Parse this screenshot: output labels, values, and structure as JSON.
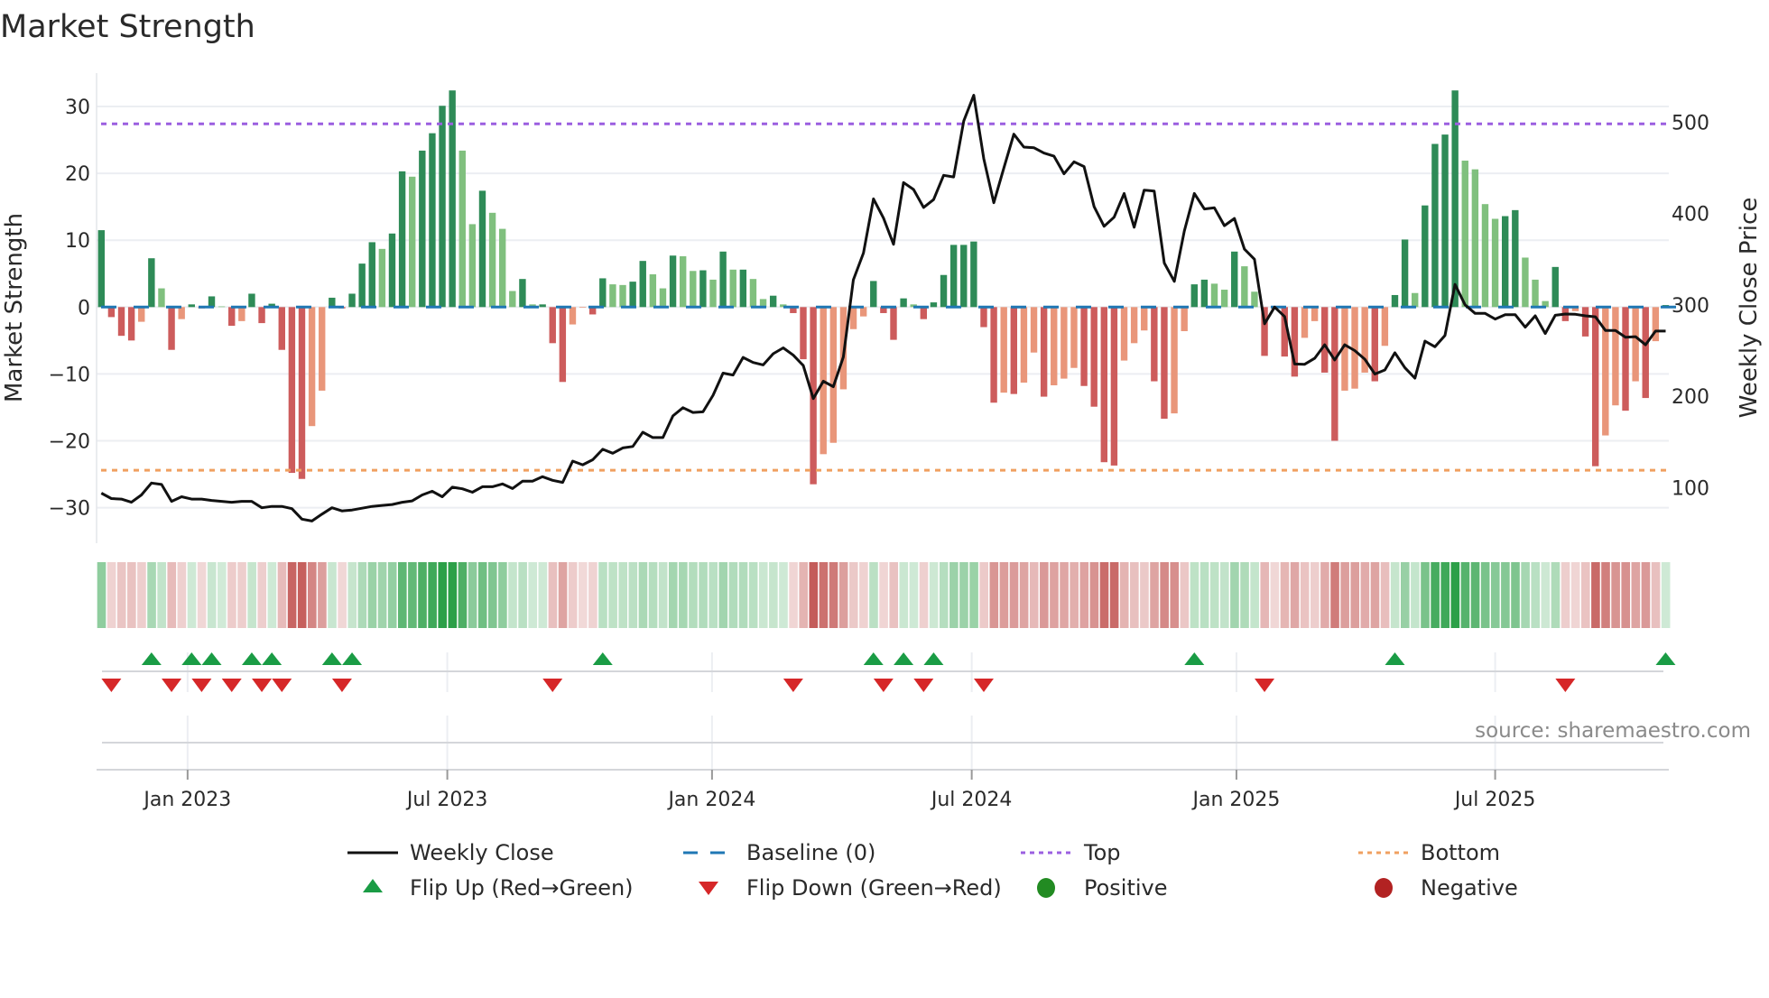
{
  "chart_data": {
    "type": "bar",
    "title": "Market Strength",
    "ylabel": "Market Strength",
    "y2label": "Weekly Close Price",
    "ylim": [
      -35,
      35
    ],
    "y2lim": [
      42,
      554
    ],
    "yticks": [
      30,
      20,
      10,
      0,
      -10,
      -20,
      -30
    ],
    "y2ticks": [
      500,
      400,
      300,
      200,
      100
    ],
    "x_unit": "week index",
    "xticks": [
      {
        "label": "Jan 2023",
        "week": 8.6
      },
      {
        "label": "Jul 2023",
        "week": 34.5
      },
      {
        "label": "Jan 2024",
        "week": 60.9
      },
      {
        "label": "Jul 2024",
        "week": 86.8
      },
      {
        "label": "Jan 2025",
        "week": 113.2
      },
      {
        "label": "Jul 2025",
        "week": 139.0
      }
    ],
    "top_level": 27.4,
    "bottom_level": -24.4,
    "baseline": 0,
    "strength": [
      11.5,
      -1.5,
      -4.3,
      -5,
      -2.2,
      7.3,
      2.8,
      -6.4,
      -1.8,
      0.4,
      -0.2,
      1.6,
      0.1,
      -2.8,
      -2.1,
      2,
      -2.4,
      0.5,
      -6.4,
      -24.8,
      -25.7,
      -17.8,
      -12.5,
      1.4,
      -0.2,
      2,
      6.5,
      9.7,
      8.7,
      11,
      20.3,
      19.5,
      23.4,
      26,
      30.1,
      32.4,
      23.4,
      12.4,
      17.4,
      14.1,
      11.7,
      2.4,
      4.2,
      0.4,
      0.4,
      -5.4,
      -11.2,
      -2.6,
      -0.1,
      -1.1,
      4.3,
      3.4,
      3.3,
      3.8,
      6.9,
      4.9,
      2.8,
      7.7,
      7.6,
      5.4,
      5.5,
      4.1,
      8.3,
      5.6,
      5.6,
      4.2,
      1.2,
      1.7,
      0.4,
      -0.9,
      -7.8,
      -26.5,
      -22,
      -20.3,
      -12.3,
      -3.3,
      -1.4,
      3.9,
      -0.9,
      -4.9,
      1.3,
      0.4,
      -1.8,
      0.7,
      4.8,
      9.3,
      9.3,
      9.8,
      -3,
      -14.3,
      -12.8,
      -13,
      -11.3,
      -6.8,
      -13.4,
      -11.7,
      -10.7,
      -9.1,
      -11.8,
      -14.9,
      -23.2,
      -23.7,
      -8,
      -5.4,
      -3.5,
      -11.1,
      -16.7,
      -15.9,
      -3.6,
      3.4,
      4.1,
      3.5,
      2.6,
      8.3,
      6.1,
      2.3,
      -7.3,
      -0.3,
      -7.4,
      -10.4,
      -4.6,
      -2.1,
      -9.8,
      -20,
      -12.5,
      -12.2,
      -9.8,
      -11.1,
      -5.8,
      1.8,
      10.1,
      2.1,
      15.2,
      24.4,
      25.8,
      32.4,
      21.9,
      20.6,
      15.4,
      13.2,
      13.6,
      14.5,
      7.4,
      4.1,
      0.9,
      6,
      -2.1,
      -0.6,
      -4.4,
      -23.8,
      -19.2,
      -14.7,
      -15.5,
      -11.1,
      -13.6,
      -5.1,
      0.3
    ],
    "weekly_close": [
      94,
      88,
      87.5,
      84,
      92,
      105,
      103.5,
      85,
      90,
      87.5,
      87.5,
      86,
      85,
      84,
      85,
      85,
      78,
      79.5,
      79.5,
      77,
      65.5,
      63.5,
      71,
      78,
      74.5,
      75.5,
      77.5,
      79.5,
      80.5,
      81.5,
      84,
      85.5,
      92,
      96,
      90,
      100.5,
      98.7,
      95,
      101,
      101,
      104,
      99,
      107,
      107,
      112,
      108,
      105.7,
      129,
      125,
      130.5,
      142,
      137.6,
      143.5,
      145,
      160.6,
      154.8,
      154.8,
      178.5,
      187.5,
      182.3,
      183,
      201,
      225.3,
      223.3,
      242.5,
      237,
      234.3,
      246.6,
      253,
      245,
      233.6,
      197.5,
      216.4,
      210.5,
      243,
      327.5,
      356.8,
      416,
      395,
      366.4,
      433.9,
      426.3,
      406.7,
      415.3,
      441.8,
      440,
      501.3,
      529.5,
      460,
      411.8,
      449.7,
      486.9,
      472.7,
      472,
      466.2,
      462.8,
      443.5,
      456.6,
      451.4,
      407.7,
      386,
      396,
      422,
      385,
      425.6,
      424.6,
      345.8,
      325.8,
      380.9,
      422,
      405,
      406.3,
      386.7,
      394.6,
      361,
      350,
      279.4,
      297.6,
      287.3,
      235.3,
      235,
      241.5,
      256.3,
      239.8,
      256.3,
      250,
      240.5,
      224.3,
      228.8,
      247.7,
      231.2,
      219.8,
      260.4,
      254.2,
      266.6,
      322.4,
      300,
      290.7,
      290.7,
      284.5,
      289.3,
      289.3,
      275.6,
      288,
      268.7,
      288.6,
      290,
      289.7,
      288,
      287,
      272,
      272,
      264.6,
      265.2,
      256.3,
      271.4,
      271.4
    ],
    "flip_up_weeks": [
      5,
      9,
      11,
      15,
      17,
      23,
      25,
      50,
      77,
      80,
      83,
      109,
      129,
      156
    ],
    "flip_down_weeks": [
      1,
      7,
      10,
      13,
      16,
      18,
      24,
      45,
      69,
      78,
      82,
      88,
      116,
      146
    ],
    "legend": {
      "placement": "bottom",
      "items": [
        {
          "label": "Weekly Close",
          "kind": "line",
          "color": "#111111"
        },
        {
          "label": "Baseline (0)",
          "kind": "dash",
          "color": "#1f77b4"
        },
        {
          "label": "Top",
          "kind": "dot",
          "color": "#9b5fe0"
        },
        {
          "label": "Bottom",
          "kind": "dot",
          "color": "#f0a060"
        },
        {
          "label": "Flip Up (Red→Green)",
          "kind": "tri-up",
          "color": "#1a9c45"
        },
        {
          "label": "Flip Down (Green→Red)",
          "kind": "tri-down",
          "color": "#d62728"
        },
        {
          "label": "Positive",
          "kind": "circle",
          "color": "#228b22"
        },
        {
          "label": "Negative",
          "kind": "circle",
          "color": "#b22222"
        }
      ]
    },
    "colors": {
      "pos_strong": "#2e8b57",
      "pos_weak": "#80c07e",
      "neg_strong": "#cd5c5c",
      "neg_weak": "#e9967a",
      "strip_pos": "#2ca048",
      "strip_neg": "#c0504d",
      "grid": "#eceef2"
    },
    "source": "source: sharemaestro.com"
  }
}
